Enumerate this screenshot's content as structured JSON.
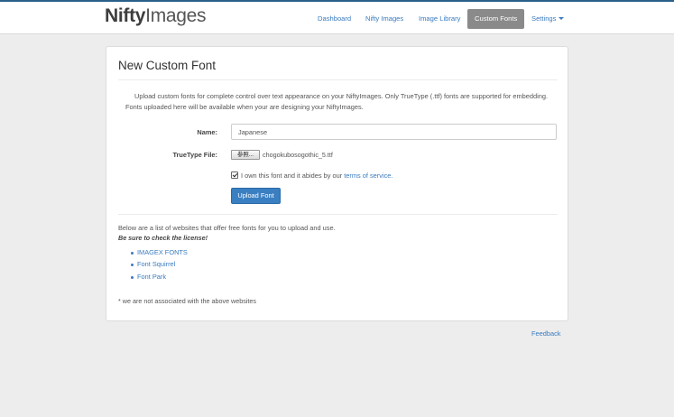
{
  "header": {
    "logo_bold": "Nifty",
    "logo_rest": "Images",
    "nav": {
      "dashboard": "Dashboard",
      "nifty_images": "Nifty Images",
      "image_library": "Image Library",
      "custom_fonts": "Custom Fonts",
      "settings": "Settings"
    }
  },
  "page": {
    "title": "New Custom Font",
    "intro": "Upload custom fonts for complete control over text appearance on your NiftyImages. Only TrueType (.ttf) fonts are supported for embedding. Fonts uploaded here will be available when your are designing your NiftyImages."
  },
  "form": {
    "name_label": "Name:",
    "name_value": "Japanese",
    "file_label": "TrueType File:",
    "file_button": "参照...",
    "file_name": "chogokubosogothic_5.ttf",
    "agree_text": "I own this font and it abides by our",
    "agree_link": "terms of service.",
    "agree_checked": true,
    "upload_button": "Upload Font"
  },
  "sites": {
    "intro": "Below are a list of websites that offer free fonts for you to upload and use.",
    "note": "Be sure to check the license!",
    "items": [
      "IMAGEX FONTS",
      "Font Squirrel",
      "Font Park"
    ],
    "disclaimer": "* we are not associated with the above websites"
  },
  "footer": {
    "feedback": "Feedback"
  },
  "colors": {
    "accent": "#3a7bbf",
    "active_tab": "#8a8a8a",
    "button": "#3a7fc1",
    "top_border": "#2a5f8a"
  }
}
